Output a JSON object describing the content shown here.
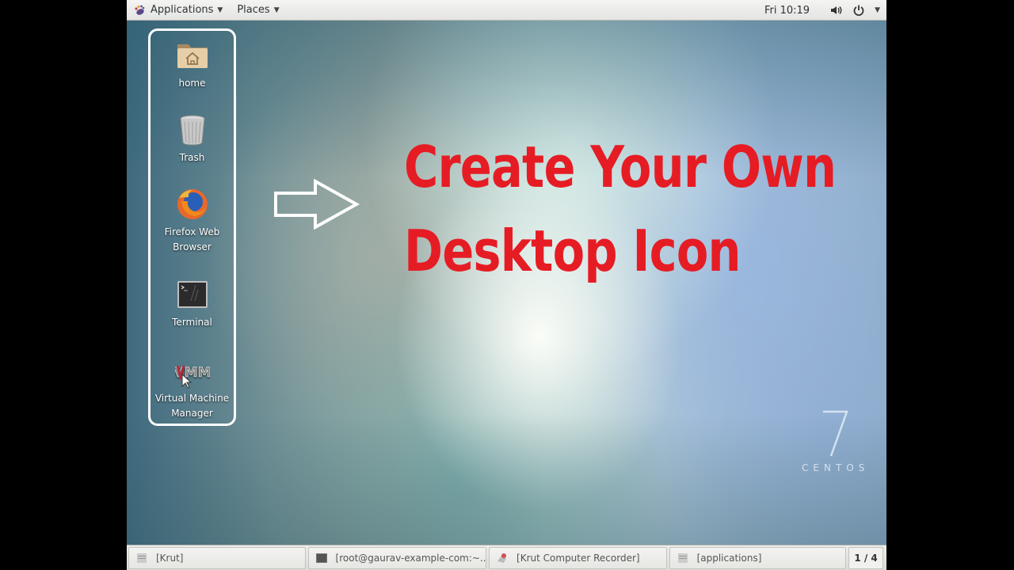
{
  "topbar": {
    "applications_label": "Applications",
    "places_label": "Places",
    "clock": "Fri 10:19",
    "icons": [
      "gnome-foot-icon",
      "volume-icon",
      "power-icon",
      "system-menu-arrow-icon"
    ]
  },
  "desktop": {
    "icons": [
      {
        "label": "home",
        "icon": "home-folder-icon"
      },
      {
        "label": "Trash",
        "icon": "trash-icon"
      },
      {
        "label": "Firefox Web Browser",
        "icon": "firefox-icon"
      },
      {
        "label": "Terminal",
        "icon": "terminal-icon"
      },
      {
        "label": "Virtual Machine Manager",
        "icon": "virt-manager-icon"
      }
    ],
    "headline_line1": "Create Your Own",
    "headline_line2": "Desktop Icon",
    "headline_color": "#e61c24",
    "logo_number": "7",
    "logo_word": "CENTOS"
  },
  "taskbar": {
    "tasks": [
      {
        "label": "[Krut]",
        "icon": "window-icon"
      },
      {
        "label": "[root@gaurav-example-com:~...",
        "icon": "terminal-icon"
      },
      {
        "label": "[Krut Computer Recorder]",
        "icon": "recorder-icon"
      },
      {
        "label": "[applications]",
        "icon": "window-icon"
      }
    ],
    "workspace": "1 / 4"
  }
}
